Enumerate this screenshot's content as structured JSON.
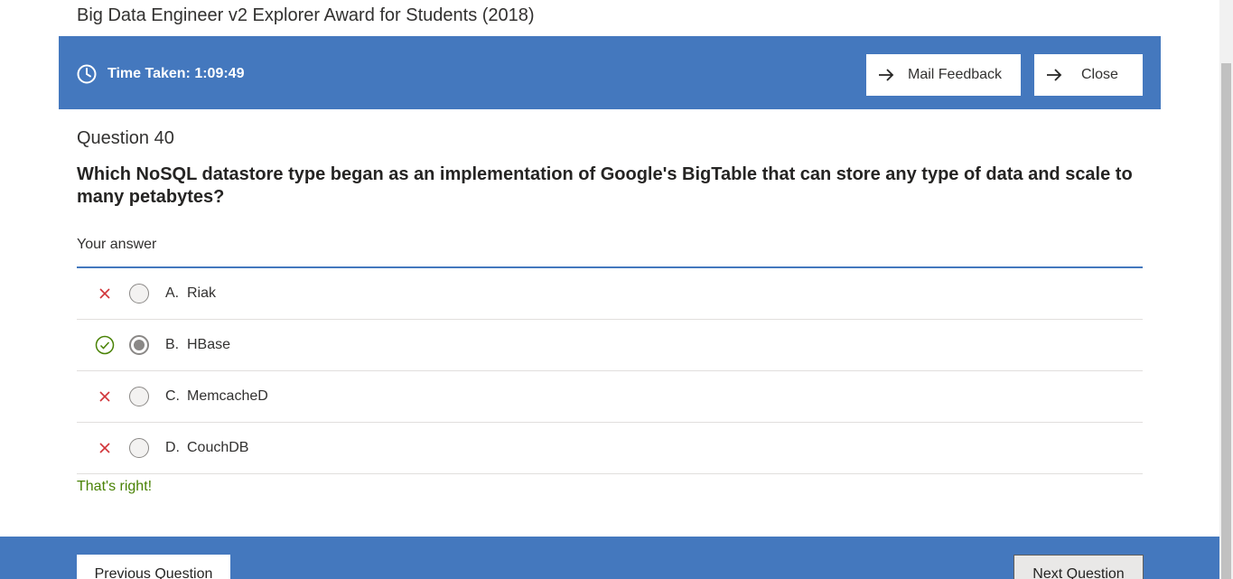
{
  "app": {
    "title": "Big Data Engineer v2 Explorer Award for Students (2018)"
  },
  "header": {
    "time_label": "Time Taken: 1:09:49",
    "mail_feedback_label": "Mail Feedback",
    "close_label": "Close",
    "bar_color": "#4478be"
  },
  "question": {
    "number_label": "Question 40",
    "text": "Which NoSQL datastore type began as an implementation of Google's BigTable that can store any type of data and scale to many petabytes?",
    "answer_heading": "Your answer"
  },
  "options": [
    {
      "letter": "A.",
      "text": "Riak",
      "status": "incorrect",
      "selected": false
    },
    {
      "letter": "B.",
      "text": "HBase",
      "status": "correct",
      "selected": true
    },
    {
      "letter": "C.",
      "text": "MemcacheD",
      "status": "incorrect",
      "selected": false
    },
    {
      "letter": "D.",
      "text": "CouchDB",
      "status": "incorrect",
      "selected": false
    }
  ],
  "feedback": {
    "text": "That's right!",
    "color": "#498205"
  },
  "footer": {
    "previous_label": "Previous Question",
    "next_label": "Next Question"
  },
  "icons": {
    "timer": "clock-icon",
    "button_arrow": "arrow-right-icon",
    "incorrect": "cross-icon",
    "correct": "check-circle-icon"
  },
  "colors": {
    "incorrect": "#d13438",
    "correct": "#498205",
    "accent": "#4478be"
  }
}
